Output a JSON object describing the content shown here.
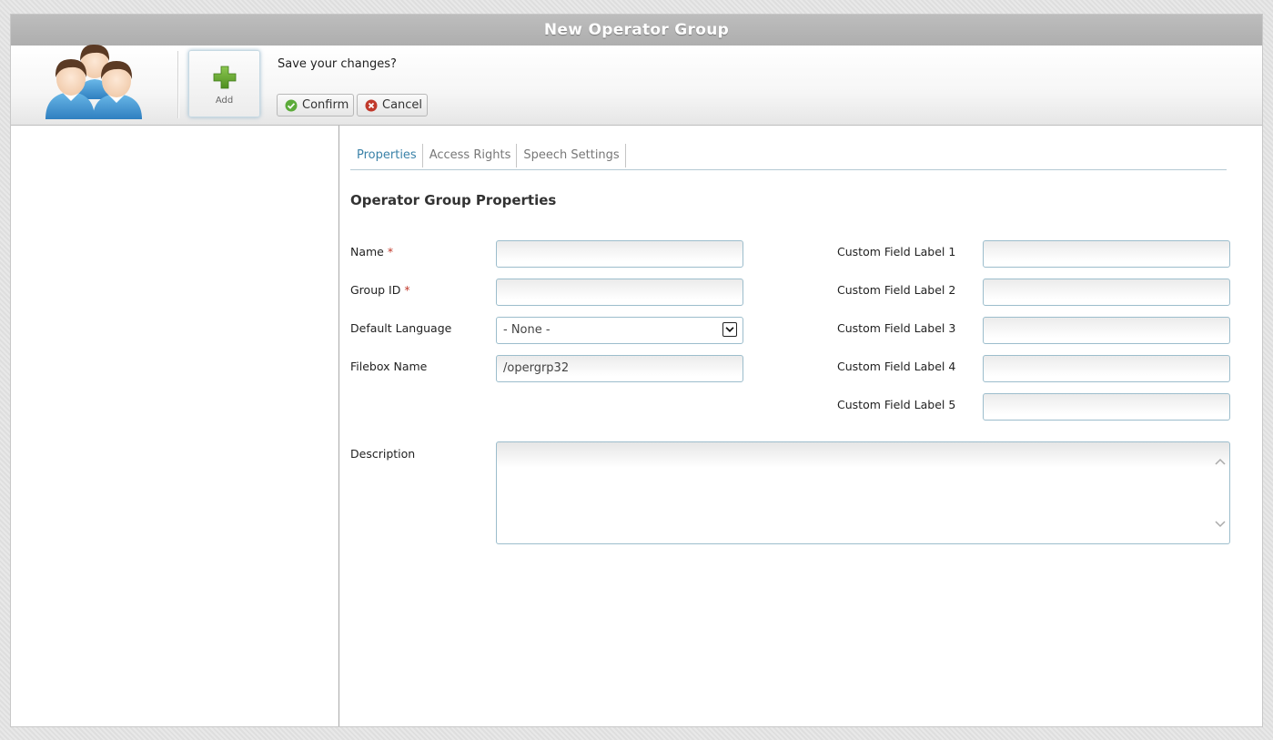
{
  "window": {
    "title": "New Operator Group"
  },
  "toolbar": {
    "add_label": "Add",
    "save_prompt": "Save your changes?",
    "confirm_label": "Confirm",
    "cancel_label": "Cancel"
  },
  "tabs": [
    {
      "label": "Properties",
      "active": true
    },
    {
      "label": "Access Rights",
      "active": false
    },
    {
      "label": "Speech Settings",
      "active": false
    }
  ],
  "form": {
    "section_title": "Operator Group Properties",
    "required_marker": "*",
    "name": {
      "label": "Name",
      "value": ""
    },
    "group_id": {
      "label": "Group ID",
      "value": ""
    },
    "default_language": {
      "label": "Default Language",
      "value": "- None -"
    },
    "filebox_name": {
      "label": "Filebox Name",
      "value": "/opergrp32"
    },
    "custom_fields": [
      {
        "label": "Custom Field Label 1",
        "value": ""
      },
      {
        "label": "Custom Field Label 2",
        "value": ""
      },
      {
        "label": "Custom Field Label 3",
        "value": ""
      },
      {
        "label": "Custom Field Label 4",
        "value": ""
      },
      {
        "label": "Custom Field Label 5",
        "value": ""
      }
    ],
    "description": {
      "label": "Description",
      "value": ""
    }
  },
  "colors": {
    "title_bar": "#b3b3b3",
    "active_tab": "#3a82a8",
    "add_icon": "#5fa12b",
    "confirm_icon": "#5cab3a",
    "cancel_icon": "#c0392b",
    "required": "#c0392b",
    "input_border": "#9cbdcc"
  },
  "icons": {
    "group_logo": "operator-group-people-icon",
    "add": "plus-icon",
    "confirm": "check-circle-icon",
    "cancel": "x-circle-icon",
    "select": "chevron-down-icon"
  }
}
